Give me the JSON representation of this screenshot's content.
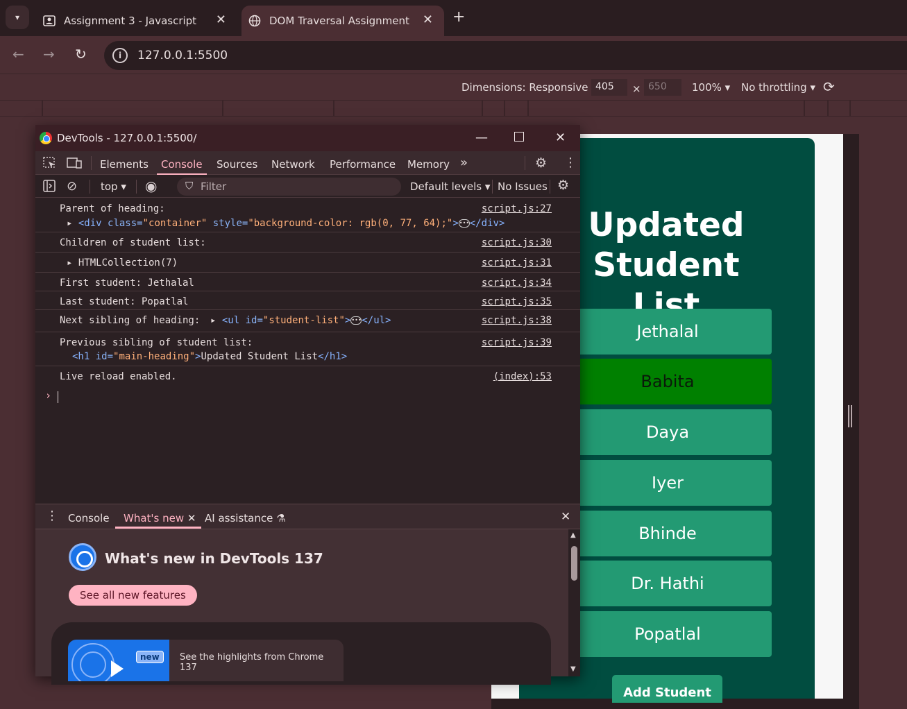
{
  "browser": {
    "tabs": [
      {
        "title": "Assignment 3 - Javascript",
        "icon": "account-box-icon"
      },
      {
        "title": "DOM Traversal Assignment",
        "icon": "globe-icon"
      }
    ],
    "url": "127.0.0.1:5500"
  },
  "device_toolbar": {
    "dimensions_label": "Dimensions: Responsive",
    "width": "405",
    "times": "×",
    "height": "650",
    "zoom": "100%",
    "throttling": "No throttling"
  },
  "page": {
    "heading_line1": "Updated",
    "heading_line2": "Student List",
    "students": [
      "Jethalal",
      "Babita",
      "Daya",
      "Iyer",
      "Bhinde",
      "Dr. Hathi",
      "Popatlal"
    ],
    "add_button": "Add Student",
    "colors": {
      "container": "#014d40",
      "item": "#239a73",
      "highlight": "#008000"
    }
  },
  "devtools": {
    "title": "DevTools - 127.0.0.1:5500/",
    "tabs": [
      "Elements",
      "Console",
      "Sources",
      "Network",
      "Performance",
      "Memory"
    ],
    "active_tab": "Console",
    "context": "top",
    "filter_placeholder": "Filter",
    "levels": "Default levels",
    "issues": "No Issues",
    "console": {
      "rows": [
        {
          "text": "Parent of heading:",
          "source": "script.js:27"
        },
        {
          "text": "Children of student list:",
          "source": "script.js:30"
        },
        {
          "text": "HTMLCollection(7)",
          "source": "script.js:31"
        },
        {
          "text": "First student: Jethalal",
          "source": "script.js:34"
        },
        {
          "text": "Last student: Popatlal",
          "source": "script.js:35"
        },
        {
          "text": "Next sibling of heading:",
          "source": "script.js:38"
        },
        {
          "text": "Previous sibling of student list:",
          "source": "script.js:39"
        },
        {
          "text": "Live reload enabled.",
          "source": "(index):53"
        }
      ],
      "parent_node": {
        "tag_open": "<div",
        "attr1": "class=",
        "val1": "\"container\"",
        "attr2": "style=",
        "val2": "\"background-color: rgb(0, 77, 64);\"",
        "close": "</div>"
      },
      "next_sibling": {
        "tag_open": "<ul",
        "attr": "id=",
        "val": "\"student-list\"",
        "close": "</ul>"
      },
      "prev_sibling": {
        "tag_open": "<h1",
        "attr": "id=",
        "val": "\"main-heading\"",
        "content": "Updated Student List",
        "close": "</h1>"
      }
    },
    "drawer": {
      "tabs": [
        "Console",
        "What's new",
        "AI assistance"
      ],
      "active_tab": "What's new",
      "whats_new_title": "What's new in DevTools 137",
      "see_all": "See all new features",
      "new_badge": "new",
      "highlight_text": "See the highlights from Chrome 137"
    }
  }
}
